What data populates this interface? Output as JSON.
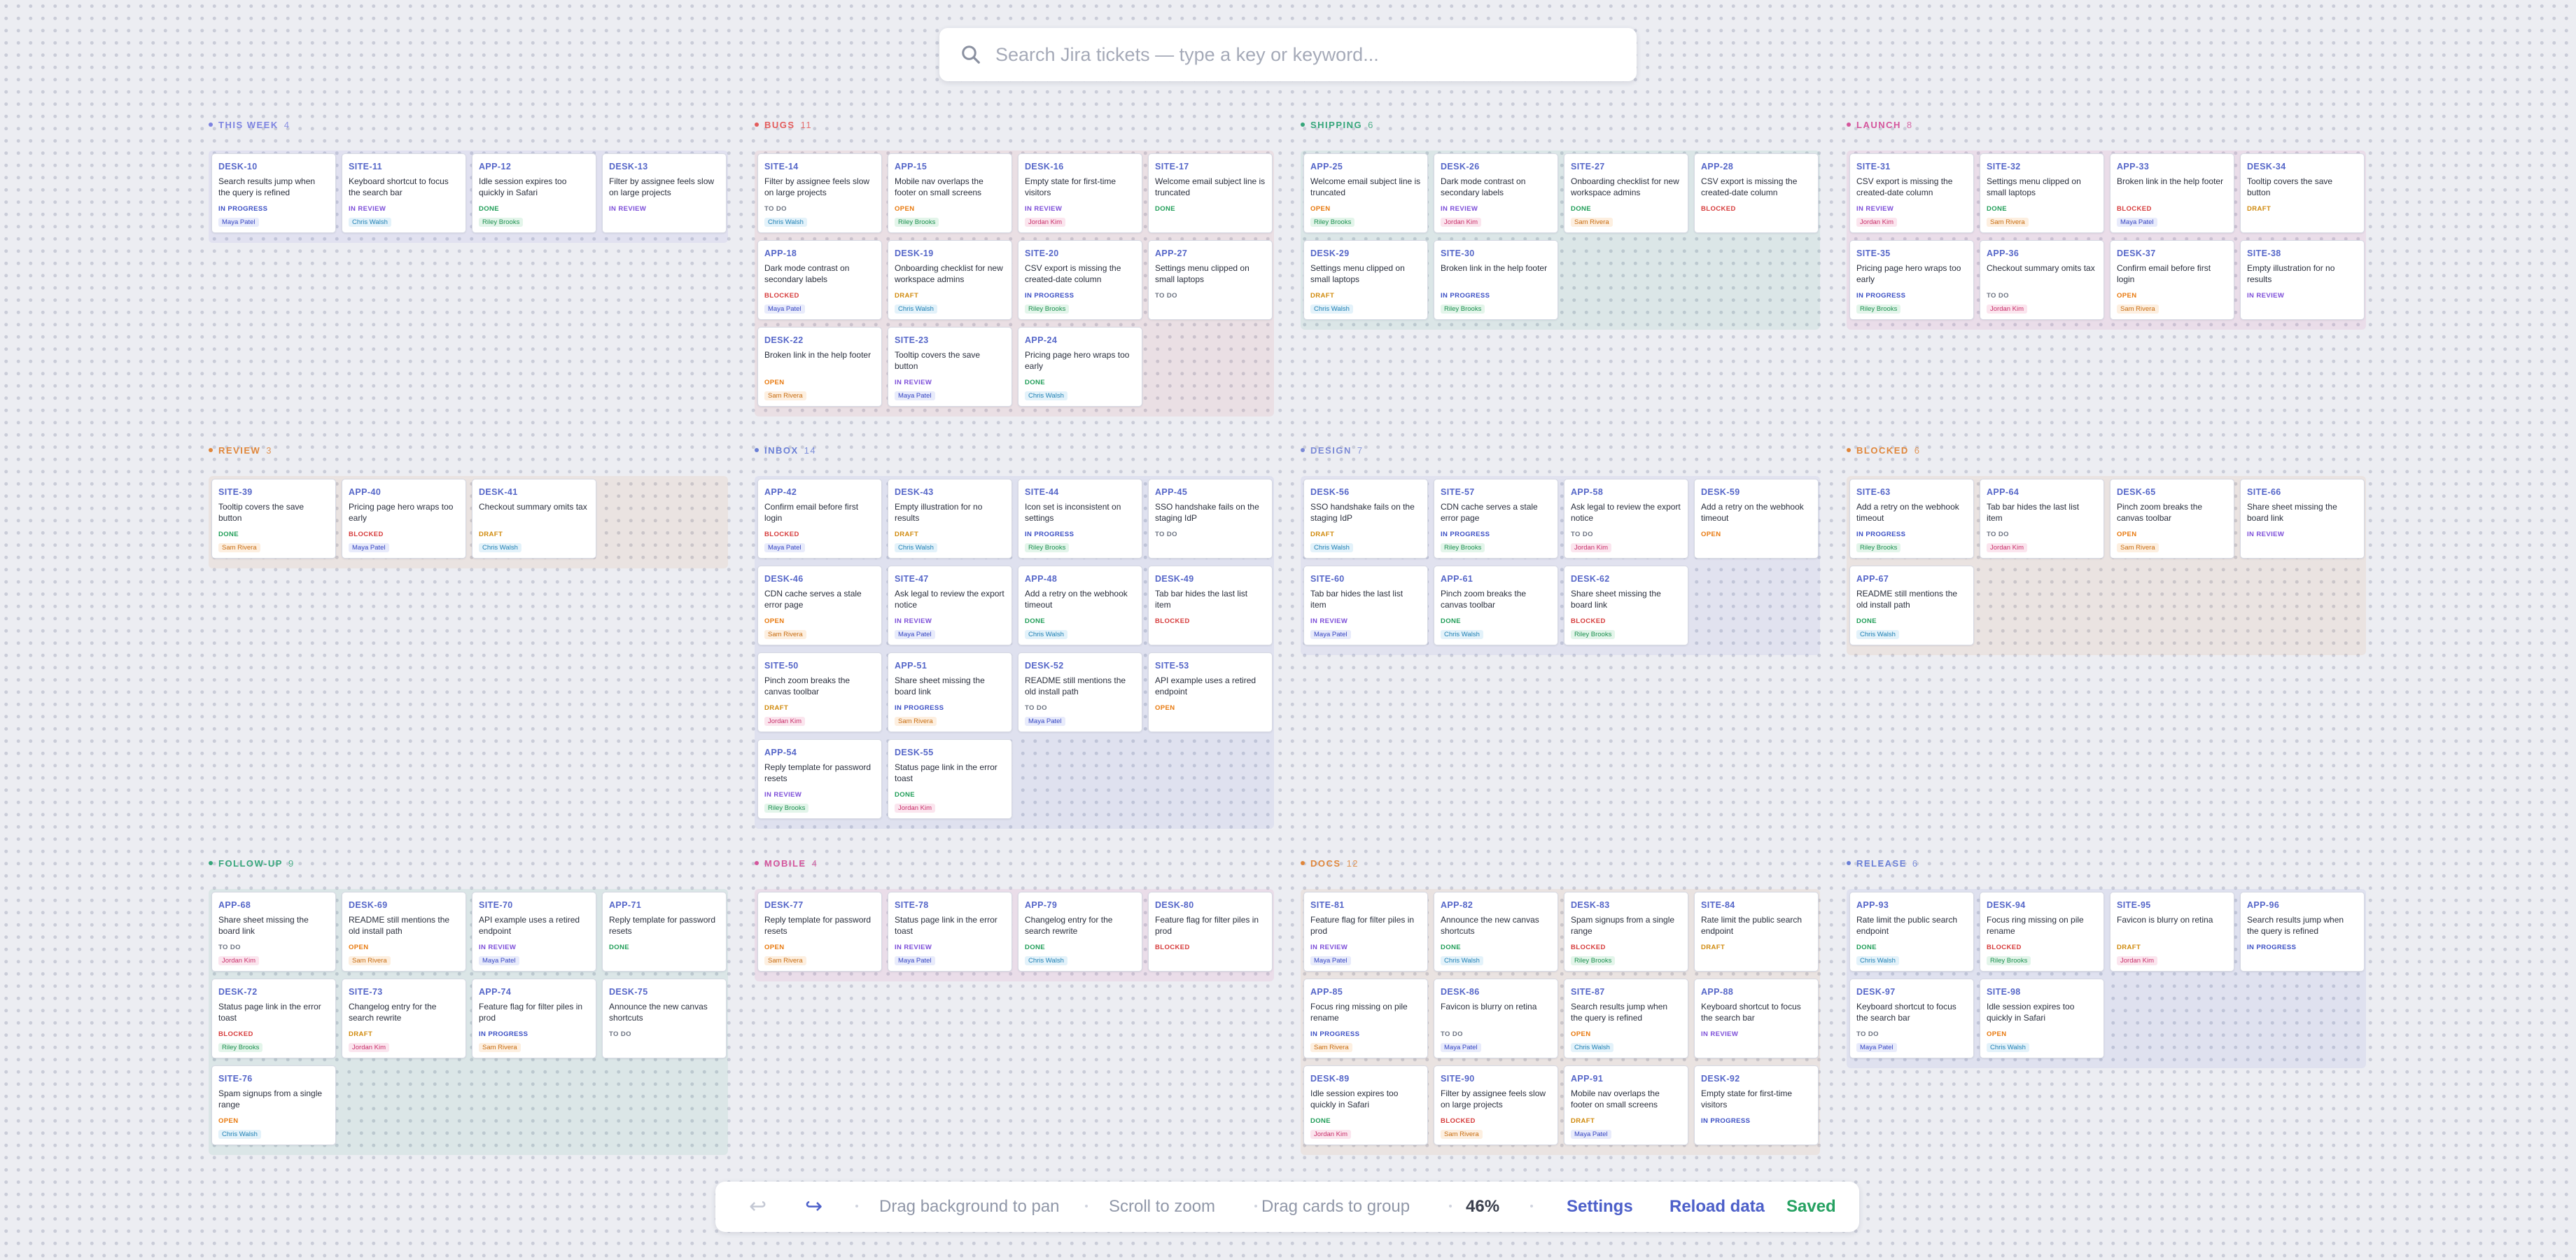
{
  "search": {
    "placeholder": "Search Jira tickets — type a key or keyword..."
  },
  "toolbar": {
    "undo_icon": "undo-arrow-icon",
    "redo_icon": "redo-arrow-icon",
    "hint_pan": "Drag background to pan",
    "hint_zoom": "Scroll to zoom",
    "hint_group": "Drag cards to group",
    "zoom_level": "46%",
    "settings_label": "Settings",
    "reload_label": "Reload data",
    "saved_label": "Saved"
  },
  "colors": {
    "open": "#e8780c",
    "to_do": "#6b7280",
    "in_progress": "#3b4fc4",
    "in_review": "#7c4dd8",
    "blocked": "#d63b3b",
    "done": "#1f9d57",
    "draft": "#d08a0c",
    "card_key": "#5566c8",
    "saved": "#25a161",
    "link": "#4c5fc9"
  },
  "groups": [
    {
      "title": "THIS WEEK",
      "count": "4",
      "color": "#7c83e0",
      "tint": "rgba(124,131,224,0.10)",
      "cards": [
        {
          "key": "DESK-10",
          "summary": "Search results jump when the query is refined",
          "status": "IN PROGRESS",
          "assignee": "Maya Patel"
        },
        {
          "key": "SITE-11",
          "summary": "Keyboard shortcut to focus the search bar",
          "status": "IN REVIEW",
          "assignee": "Chris Walsh"
        },
        {
          "key": "APP-12",
          "summary": "Idle session expires too quickly in Safari",
          "status": "DONE",
          "assignee": "Riley Brooks"
        },
        {
          "key": "DESK-13",
          "summary": "Filter by assignee feels slow on large projects",
          "status": "IN REVIEW",
          "assignee": ""
        }
      ]
    },
    {
      "title": "BUGS",
      "count": "11",
      "color": "#e35b5b",
      "tint": "rgba(227,91,91,0.09)",
      "cards": [
        {
          "key": "SITE-14",
          "summary": "Filter by assignee feels slow on large projects",
          "status": "TO DO",
          "assignee": "Chris Walsh"
        },
        {
          "key": "APP-15",
          "summary": "Mobile nav overlaps the footer on small screens",
          "status": "OPEN",
          "assignee": "Riley Brooks"
        },
        {
          "key": "DESK-16",
          "summary": "Empty state for first-time visitors",
          "status": "IN REVIEW",
          "assignee": "Jordan Kim"
        },
        {
          "key": "SITE-17",
          "summary": "Welcome email subject line is truncated",
          "status": "DONE",
          "assignee": ""
        },
        {
          "key": "APP-18",
          "summary": "Dark mode contrast on secondary labels",
          "status": "BLOCKED",
          "assignee": "Maya Patel"
        },
        {
          "key": "DESK-19",
          "summary": "Onboarding checklist for new workspace admins",
          "status": "DRAFT",
          "assignee": "Chris Walsh"
        },
        {
          "key": "SITE-20",
          "summary": "CSV export is missing the created-date column",
          "status": "IN PROGRESS",
          "assignee": "Riley Brooks"
        },
        {
          "key": "APP-27",
          "summary": "Settings menu clipped on small laptops",
          "status": "TO DO",
          "assignee": ""
        },
        {
          "key": "DESK-22",
          "summary": "Broken link in the help footer",
          "status": "OPEN",
          "assignee": "Sam Rivera"
        },
        {
          "key": "SITE-23",
          "summary": "Tooltip covers the save button",
          "status": "IN REVIEW",
          "assignee": "Maya Patel"
        },
        {
          "key": "APP-24",
          "summary": "Pricing page hero wraps too early",
          "status": "DONE",
          "assignee": "Chris Walsh"
        }
      ]
    },
    {
      "title": "SHIPPING",
      "count": "6",
      "color": "#35a57a",
      "tint": "rgba(53,165,122,0.09)",
      "cards": [
        {
          "key": "APP-25",
          "summary": "Welcome email subject line is truncated",
          "status": "OPEN",
          "assignee": "Riley Brooks"
        },
        {
          "key": "DESK-26",
          "summary": "Dark mode contrast on secondary labels",
          "status": "IN REVIEW",
          "assignee": "Jordan Kim"
        },
        {
          "key": "SITE-27",
          "summary": "Onboarding checklist for new workspace admins",
          "status": "DONE",
          "assignee": "Sam Rivera"
        },
        {
          "key": "APP-28",
          "summary": "CSV export is missing the created-date column",
          "status": "BLOCKED",
          "assignee": ""
        },
        {
          "key": "DESK-29",
          "summary": "Settings menu clipped on small laptops",
          "status": "DRAFT",
          "assignee": "Chris Walsh"
        },
        {
          "key": "SITE-30",
          "summary": "Broken link in the help footer",
          "status": "IN PROGRESS",
          "assignee": "Riley Brooks"
        }
      ]
    },
    {
      "title": "LAUNCH",
      "count": "8",
      "color": "#d4559c",
      "tint": "rgba(212,85,156,0.10)",
      "cards": [
        {
          "key": "SITE-31",
          "summary": "CSV export is missing the created-date column",
          "status": "IN REVIEW",
          "assignee": "Jordan Kim"
        },
        {
          "key": "SITE-32",
          "summary": "Settings menu clipped on small laptops",
          "status": "DONE",
          "assignee": "Sam Rivera"
        },
        {
          "key": "APP-33",
          "summary": "Broken link in the help footer",
          "status": "BLOCKED",
          "assignee": "Maya Patel"
        },
        {
          "key": "DESK-34",
          "summary": "Tooltip covers the save button",
          "status": "DRAFT",
          "assignee": ""
        },
        {
          "key": "SITE-35",
          "summary": "Pricing page hero wraps too early",
          "status": "IN PROGRESS",
          "assignee": "Riley Brooks"
        },
        {
          "key": "APP-36",
          "summary": "Checkout summary omits tax",
          "status": "TO DO",
          "assignee": "Jordan Kim"
        },
        {
          "key": "DESK-37",
          "summary": "Confirm email before first login",
          "status": "OPEN",
          "assignee": "Sam Rivera"
        },
        {
          "key": "SITE-38",
          "summary": "Empty illustration for no results",
          "status": "IN REVIEW",
          "assignee": ""
        }
      ]
    },
    {
      "title": "REVIEW",
      "count": "3",
      "color": "#e0863a",
      "tint": "rgba(224,134,58,0.09)",
      "cards": [
        {
          "key": "SITE-39",
          "summary": "Tooltip covers the save button",
          "status": "DONE",
          "assignee": "Sam Rivera"
        },
        {
          "key": "APP-40",
          "summary": "Pricing page hero wraps too early",
          "status": "BLOCKED",
          "assignee": "Maya Patel"
        },
        {
          "key": "DESK-41",
          "summary": "Checkout summary omits tax",
          "status": "DRAFT",
          "assignee": "Chris Walsh"
        }
      ]
    },
    {
      "title": "INBOX",
      "count": "14",
      "color": "#6a7fd6",
      "tint": "rgba(106,127,214,0.10)",
      "cards": [
        {
          "key": "APP-42",
          "summary": "Confirm email before first login",
          "status": "BLOCKED",
          "assignee": "Maya Patel"
        },
        {
          "key": "DESK-43",
          "summary": "Empty illustration for no results",
          "status": "DRAFT",
          "assignee": "Chris Walsh"
        },
        {
          "key": "SITE-44",
          "summary": "Icon set is inconsistent on settings",
          "status": "IN PROGRESS",
          "assignee": "Riley Brooks"
        },
        {
          "key": "APP-45",
          "summary": "SSO handshake fails on the staging IdP",
          "status": "TO DO",
          "assignee": ""
        },
        {
          "key": "DESK-46",
          "summary": "CDN cache serves a stale error page",
          "status": "OPEN",
          "assignee": "Sam Rivera"
        },
        {
          "key": "SITE-47",
          "summary": "Ask legal to review the export notice",
          "status": "IN REVIEW",
          "assignee": "Maya Patel"
        },
        {
          "key": "APP-48",
          "summary": "Add a retry on the webhook timeout",
          "status": "DONE",
          "assignee": "Chris Walsh"
        },
        {
          "key": "DESK-49",
          "summary": "Tab bar hides the last list item",
          "status": "BLOCKED",
          "assignee": ""
        },
        {
          "key": "SITE-50",
          "summary": "Pinch zoom breaks the canvas toolbar",
          "status": "DRAFT",
          "assignee": "Jordan Kim"
        },
        {
          "key": "APP-51",
          "summary": "Share sheet missing the board link",
          "status": "IN PROGRESS",
          "assignee": "Sam Rivera"
        },
        {
          "key": "DESK-52",
          "summary": "README still mentions the old install path",
          "status": "TO DO",
          "assignee": "Maya Patel"
        },
        {
          "key": "SITE-53",
          "summary": "API example uses a retired endpoint",
          "status": "OPEN",
          "assignee": ""
        },
        {
          "key": "APP-54",
          "summary": "Reply template for password resets",
          "status": "IN REVIEW",
          "assignee": "Riley Brooks"
        },
        {
          "key": "DESK-55",
          "summary": "Status page link in the error toast",
          "status": "DONE",
          "assignee": "Jordan Kim"
        }
      ]
    },
    {
      "title": "DESIGN",
      "count": "7",
      "color": "#7b8ad6",
      "tint": "rgba(123,138,214,0.10)",
      "cards": [
        {
          "key": "DESK-56",
          "summary": "SSO handshake fails on the staging IdP",
          "status": "DRAFT",
          "assignee": "Chris Walsh"
        },
        {
          "key": "SITE-57",
          "summary": "CDN cache serves a stale error page",
          "status": "IN PROGRESS",
          "assignee": "Riley Brooks"
        },
        {
          "key": "APP-58",
          "summary": "Ask legal to review the export notice",
          "status": "TO DO",
          "assignee": "Jordan Kim"
        },
        {
          "key": "DESK-59",
          "summary": "Add a retry on the webhook timeout",
          "status": "OPEN",
          "assignee": ""
        },
        {
          "key": "SITE-60",
          "summary": "Tab bar hides the last list item",
          "status": "IN REVIEW",
          "assignee": "Maya Patel"
        },
        {
          "key": "APP-61",
          "summary": "Pinch zoom breaks the canvas toolbar",
          "status": "DONE",
          "assignee": "Chris Walsh"
        },
        {
          "key": "DESK-62",
          "summary": "Share sheet missing the board link",
          "status": "BLOCKED",
          "assignee": "Riley Brooks"
        }
      ]
    },
    {
      "title": "BLOCKED",
      "count": "6",
      "color": "#e0863a",
      "tint": "rgba(224,134,58,0.09)",
      "cards": [
        {
          "key": "SITE-63",
          "summary": "Add a retry on the webhook timeout",
          "status": "IN PROGRESS",
          "assignee": "Riley Brooks"
        },
        {
          "key": "APP-64",
          "summary": "Tab bar hides the last list item",
          "status": "TO DO",
          "assignee": "Jordan Kim"
        },
        {
          "key": "DESK-65",
          "summary": "Pinch zoom breaks the canvas toolbar",
          "status": "OPEN",
          "assignee": "Sam Rivera"
        },
        {
          "key": "SITE-66",
          "summary": "Share sheet missing the board link",
          "status": "IN REVIEW",
          "assignee": ""
        },
        {
          "key": "APP-67",
          "summary": "README still mentions the old install path",
          "status": "DONE",
          "assignee": "Chris Walsh"
        }
      ]
    },
    {
      "title": "FOLLOW-UP",
      "count": "9",
      "color": "#35a57a",
      "tint": "rgba(53,165,122,0.09)",
      "cards": [
        {
          "key": "APP-68",
          "summary": "Share sheet missing the board link",
          "status": "TO DO",
          "assignee": "Jordan Kim"
        },
        {
          "key": "DESK-69",
          "summary": "README still mentions the old install path",
          "status": "OPEN",
          "assignee": "Sam Rivera"
        },
        {
          "key": "SITE-70",
          "summary": "API example uses a retired endpoint",
          "status": "IN REVIEW",
          "assignee": "Maya Patel"
        },
        {
          "key": "APP-71",
          "summary": "Reply template for password resets",
          "status": "DONE",
          "assignee": ""
        },
        {
          "key": "DESK-72",
          "summary": "Status page link in the error toast",
          "status": "BLOCKED",
          "assignee": "Riley Brooks"
        },
        {
          "key": "SITE-73",
          "summary": "Changelog entry for the search rewrite",
          "status": "DRAFT",
          "assignee": "Jordan Kim"
        },
        {
          "key": "APP-74",
          "summary": "Feature flag for filter piles in prod",
          "status": "IN PROGRESS",
          "assignee": "Sam Rivera"
        },
        {
          "key": "DESK-75",
          "summary": "Announce the new canvas shortcuts",
          "status": "TO DO",
          "assignee": ""
        },
        {
          "key": "SITE-76",
          "summary": "Spam signups from a single range",
          "status": "OPEN",
          "assignee": "Chris Walsh"
        }
      ]
    },
    {
      "title": "MOBILE",
      "count": "4",
      "color": "#d4559c",
      "tint": "rgba(212,85,156,0.10)",
      "cards": [
        {
          "key": "DESK-77",
          "summary": "Reply template for password resets",
          "status": "OPEN",
          "assignee": "Sam Rivera"
        },
        {
          "key": "SITE-78",
          "summary": "Status page link in the error toast",
          "status": "IN REVIEW",
          "assignee": "Maya Patel"
        },
        {
          "key": "APP-79",
          "summary": "Changelog entry for the search rewrite",
          "status": "DONE",
          "assignee": "Chris Walsh"
        },
        {
          "key": "DESK-80",
          "summary": "Feature flag for filter piles in prod",
          "status": "BLOCKED",
          "assignee": ""
        }
      ]
    },
    {
      "title": "DOCS",
      "count": "12",
      "color": "#e0863a",
      "tint": "rgba(224,134,58,0.09)",
      "cards": [
        {
          "key": "SITE-81",
          "summary": "Feature flag for filter piles in prod",
          "status": "IN REVIEW",
          "assignee": "Maya Patel"
        },
        {
          "key": "APP-82",
          "summary": "Announce the new canvas shortcuts",
          "status": "DONE",
          "assignee": "Chris Walsh"
        },
        {
          "key": "DESK-83",
          "summary": "Spam signups from a single range",
          "status": "BLOCKED",
          "assignee": "Riley Brooks"
        },
        {
          "key": "SITE-84",
          "summary": "Rate limit the public search endpoint",
          "status": "DRAFT",
          "assignee": ""
        },
        {
          "key": "APP-85",
          "summary": "Focus ring missing on pile rename",
          "status": "IN PROGRESS",
          "assignee": "Sam Rivera"
        },
        {
          "key": "DESK-86",
          "summary": "Favicon is blurry on retina",
          "status": "TO DO",
          "assignee": "Maya Patel"
        },
        {
          "key": "SITE-87",
          "summary": "Search results jump when the query is refined",
          "status": "OPEN",
          "assignee": "Chris Walsh"
        },
        {
          "key": "APP-88",
          "summary": "Keyboard shortcut to focus the search bar",
          "status": "IN REVIEW",
          "assignee": ""
        },
        {
          "key": "DESK-89",
          "summary": "Idle session expires too quickly in Safari",
          "status": "DONE",
          "assignee": "Jordan Kim"
        },
        {
          "key": "SITE-90",
          "summary": "Filter by assignee feels slow on large projects",
          "status": "BLOCKED",
          "assignee": "Sam Rivera"
        },
        {
          "key": "APP-91",
          "summary": "Mobile nav overlaps the footer on small screens",
          "status": "DRAFT",
          "assignee": "Maya Patel"
        },
        {
          "key": "DESK-92",
          "summary": "Empty state for first-time visitors",
          "status": "IN PROGRESS",
          "assignee": ""
        }
      ]
    },
    {
      "title": "RELEASE",
      "count": "6",
      "color": "#6a7fd6",
      "tint": "rgba(106,127,214,0.10)",
      "cards": [
        {
          "key": "APP-93",
          "summary": "Rate limit the public search endpoint",
          "status": "DONE",
          "assignee": "Chris Walsh"
        },
        {
          "key": "DESK-94",
          "summary": "Focus ring missing on pile rename",
          "status": "BLOCKED",
          "assignee": "Riley Brooks"
        },
        {
          "key": "SITE-95",
          "summary": "Favicon is blurry on retina",
          "status": "DRAFT",
          "assignee": "Jordan Kim"
        },
        {
          "key": "APP-96",
          "summary": "Search results jump when the query is refined",
          "status": "IN PROGRESS",
          "assignee": ""
        },
        {
          "key": "DESK-97",
          "summary": "Keyboard shortcut to focus the search bar",
          "status": "TO DO",
          "assignee": "Maya Patel"
        },
        {
          "key": "SITE-98",
          "summary": "Idle session expires too quickly in Safari",
          "status": "OPEN",
          "assignee": "Chris Walsh"
        }
      ]
    }
  ]
}
